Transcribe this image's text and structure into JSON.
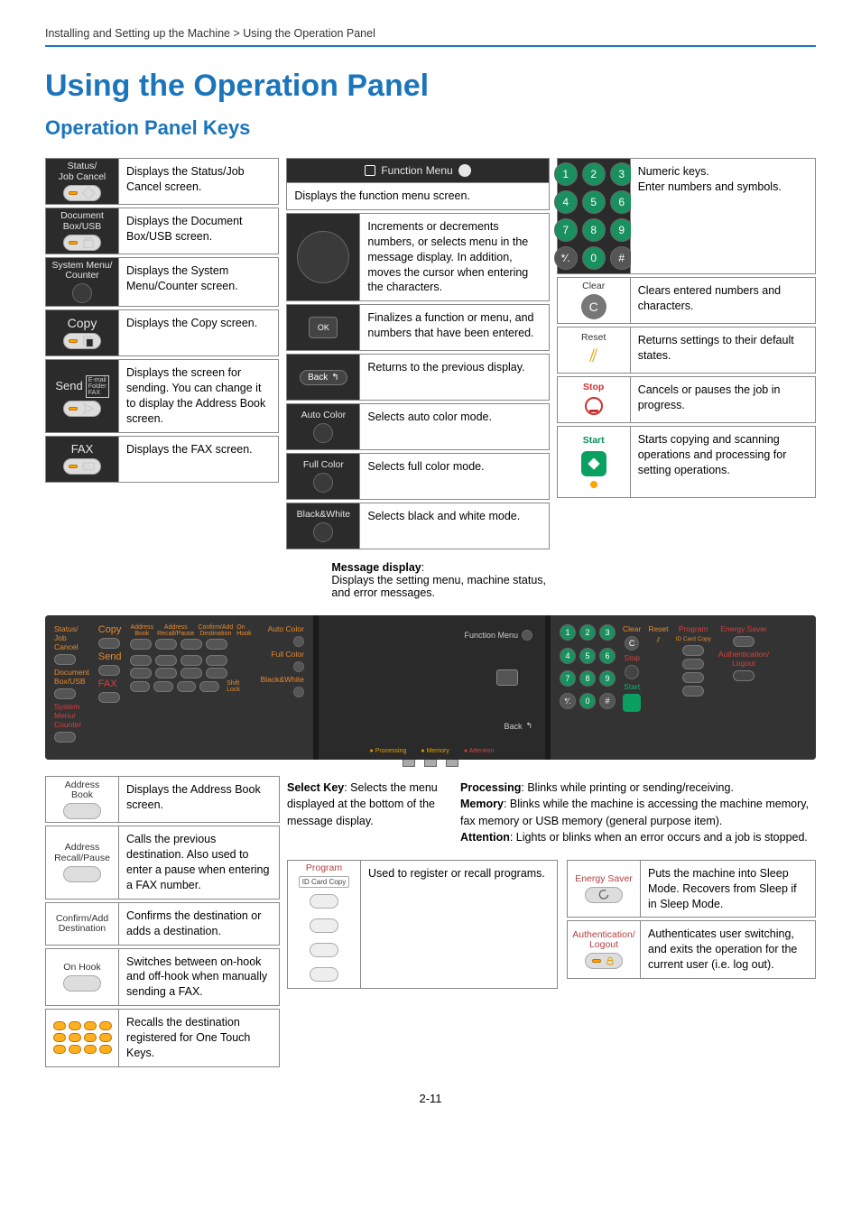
{
  "breadcrumb": "Installing and Setting up the Machine > Using the Operation Panel",
  "title": "Using the Operation Panel",
  "subtitle": "Operation Panel Keys",
  "page_num": "2-11",
  "colA": {
    "status": {
      "key": "Status/\nJob Cancel",
      "desc": "Displays the Status/Job Cancel screen."
    },
    "docbox": {
      "key": "Document\nBox/USB",
      "desc": "Displays the Document Box/USB screen."
    },
    "sysmenu": {
      "key": "System Menu/\nCounter",
      "desc": "Displays the System Menu/Counter screen."
    },
    "copy": {
      "key": "Copy",
      "desc": "Displays the Copy screen."
    },
    "send": {
      "key": "Send",
      "tags": "E-mail\nFolder\nFAX",
      "desc": "Displays the screen for sending. You can change it to display the Address Book screen."
    },
    "fax": {
      "key": "FAX",
      "desc": "Displays the FAX screen."
    }
  },
  "colB": {
    "funcmenu": {
      "key": "Function Menu",
      "desc": "Displays the function menu screen."
    },
    "arrows": "Increments or decrements numbers, or selects menu in the message display. In addition, moves the cursor when entering the characters.",
    "ok": "Finalizes a function or menu, and numbers that have been entered.",
    "back": {
      "key": "Back",
      "desc": "Returns to the previous display."
    },
    "autocolor": {
      "key": "Auto Color",
      "desc": "Selects auto color mode."
    },
    "fullcolor": {
      "key": "Full Color",
      "desc": "Selects full color mode."
    },
    "bw": {
      "key": "Black&White",
      "desc": "Selects black and white mode."
    }
  },
  "colC": {
    "numeric": "Numeric keys.\nEnter numbers and symbols.",
    "clear": {
      "key": "Clear",
      "sym": "C",
      "desc": "Clears entered numbers and characters."
    },
    "reset": {
      "key": "Reset",
      "desc": "Returns settings to their default states."
    },
    "stop": {
      "key": "Stop",
      "desc": "Cancels or pauses the job in progress."
    },
    "start": {
      "key": "Start",
      "desc": "Starts copying and scanning operations and processing for setting operations."
    }
  },
  "msg": {
    "title": "Message display",
    "body": "Displays the setting menu, machine status, and error messages."
  },
  "photo": {
    "left": {
      "copy": "Copy",
      "send": "Send",
      "fax": "FAX",
      "auto": "Auto Color",
      "full": "Full Color",
      "bw": "Black&White",
      "status": "Status/\nJob Cancel",
      "doc": "Document\nBox/USB",
      "sys": "System Menu/\nCounter",
      "addr": "Address\nBook",
      "recall": "Address\nRecall/Pause",
      "confirm": "Confirm/Add\nDestination",
      "onhook": "On Hook",
      "shift": "Shift Lock"
    },
    "mid": {
      "func": "Function Menu",
      "back": "Back",
      "led1": "Processing",
      "led2": "Memory",
      "led3": "Attention"
    },
    "right": {
      "clear": "Clear",
      "reset": "Reset",
      "stop": "Stop",
      "start": "Start",
      "prog": "Program",
      "idcard": "ID Card Copy",
      "energy": "Energy Saver",
      "auth": "Authentication/\nLogout"
    }
  },
  "sec2A": {
    "addrbook": {
      "key": "Address\nBook",
      "desc": "Displays the Address Book screen."
    },
    "recall": {
      "key": "Address\nRecall/Pause",
      "desc": "Calls the previous destination. Also used to enter a pause when entering a FAX number."
    },
    "confirm": {
      "key": "Confirm/Add\nDestination",
      "desc": "Confirms the destination or adds a destination."
    },
    "onhook": {
      "key": "On Hook",
      "desc": "Switches between on-hook and off-hook when manually sending a FAX."
    },
    "onetouch": "Recalls the destination registered for One Touch Keys."
  },
  "sec2mid": {
    "selectkey": {
      "t": "Select Key",
      "body": ": Selects the menu displayed at the bottom of the message display."
    },
    "program": {
      "key": "Program",
      "sub": "ID Card Copy",
      "desc": "Used to register or recall programs."
    }
  },
  "sec2right": {
    "processing": {
      "t": "Processing",
      "body": ": Blinks while printing or sending/receiving."
    },
    "memory": {
      "t": "Memory",
      "body": ": Blinks while the machine is accessing the machine memory, fax memory or USB memory (general purpose item)."
    },
    "attention": {
      "t": "Attention",
      "body": ": Lights or blinks when an error occurs and a job is stopped."
    },
    "energy": {
      "key": "Energy Saver",
      "desc": "Puts the machine into Sleep Mode. Recovers from Sleep if in Sleep Mode."
    },
    "auth": {
      "key": "Authentication/\nLogout",
      "desc": "Authenticates user switching, and exits the operation for the current user (i.e. log out)."
    }
  },
  "nums": [
    "1",
    "2",
    "3",
    "4",
    "5",
    "6",
    "7",
    "8",
    "9",
    "*⁄.",
    "0",
    "#"
  ]
}
